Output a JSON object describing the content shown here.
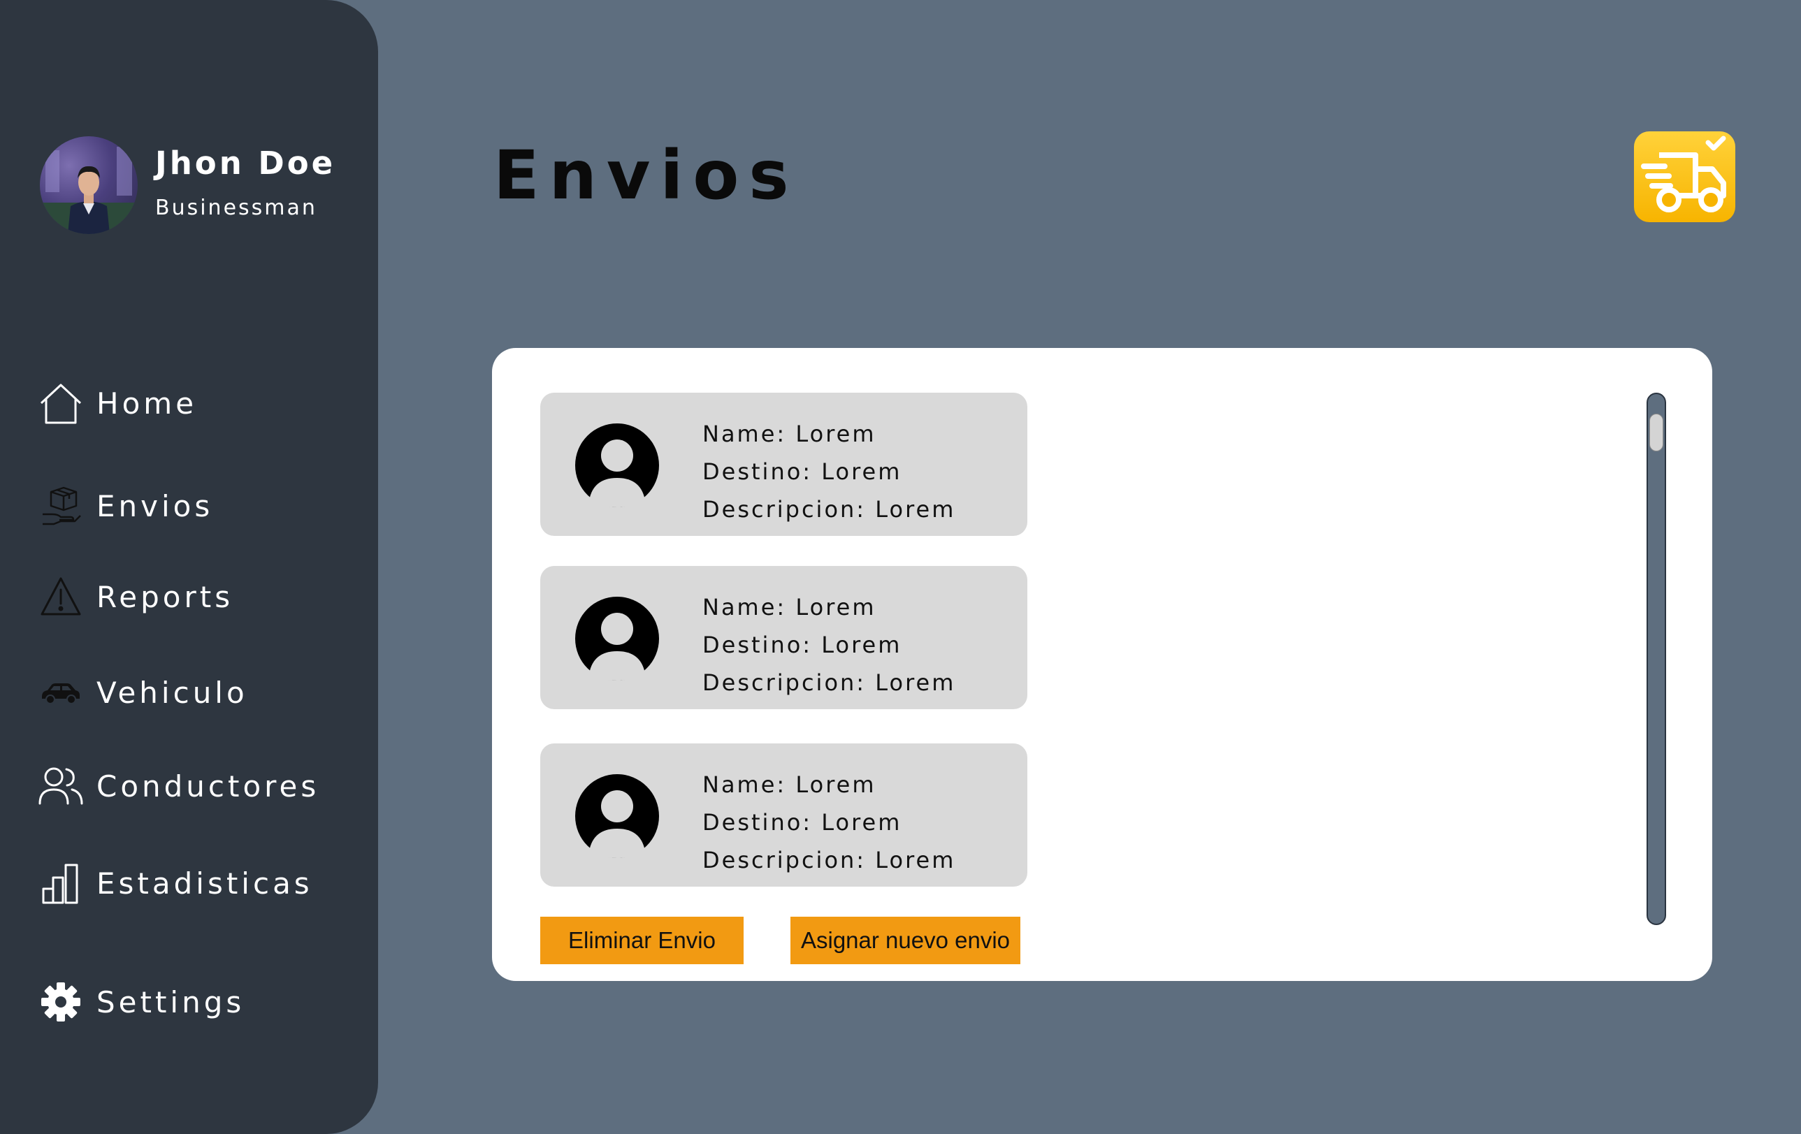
{
  "profile": {
    "name": "Jhon Doe",
    "role": "Businessman"
  },
  "sidebar": {
    "items": [
      {
        "label": "Home",
        "icon": "home-icon"
      },
      {
        "label": "Envios",
        "icon": "package-icon"
      },
      {
        "label": "Reports",
        "icon": "warning-icon"
      },
      {
        "label": "Vehiculo",
        "icon": "car-icon"
      },
      {
        "label": "Conductores",
        "icon": "users-icon"
      },
      {
        "label": "Estadisticas",
        "icon": "bar-chart-icon"
      },
      {
        "label": "Settings",
        "icon": "gear-icon"
      }
    ]
  },
  "header": {
    "title": "Envios",
    "badge_icon": "delivery-truck-icon"
  },
  "shipments": [
    {
      "name": "Name: Lorem",
      "destino": "Destino: Lorem",
      "descripcion": "Descripcion: Lorem"
    },
    {
      "name": "Name: Lorem",
      "destino": "Destino: Lorem",
      "descripcion": "Descripcion: Lorem"
    },
    {
      "name": "Name: Lorem",
      "destino": "Destino: Lorem",
      "descripcion": "Descripcion: Lorem"
    }
  ],
  "actions": {
    "delete_label": "Eliminar Envio",
    "assign_label": "Asignar nuevo envio"
  },
  "colors": {
    "background": "#5e6e7f",
    "sidebar": "#2e3640",
    "panel": "#ffffff",
    "card": "#d9d9d9",
    "button": "#f29a12",
    "badge": "#f7b400"
  }
}
